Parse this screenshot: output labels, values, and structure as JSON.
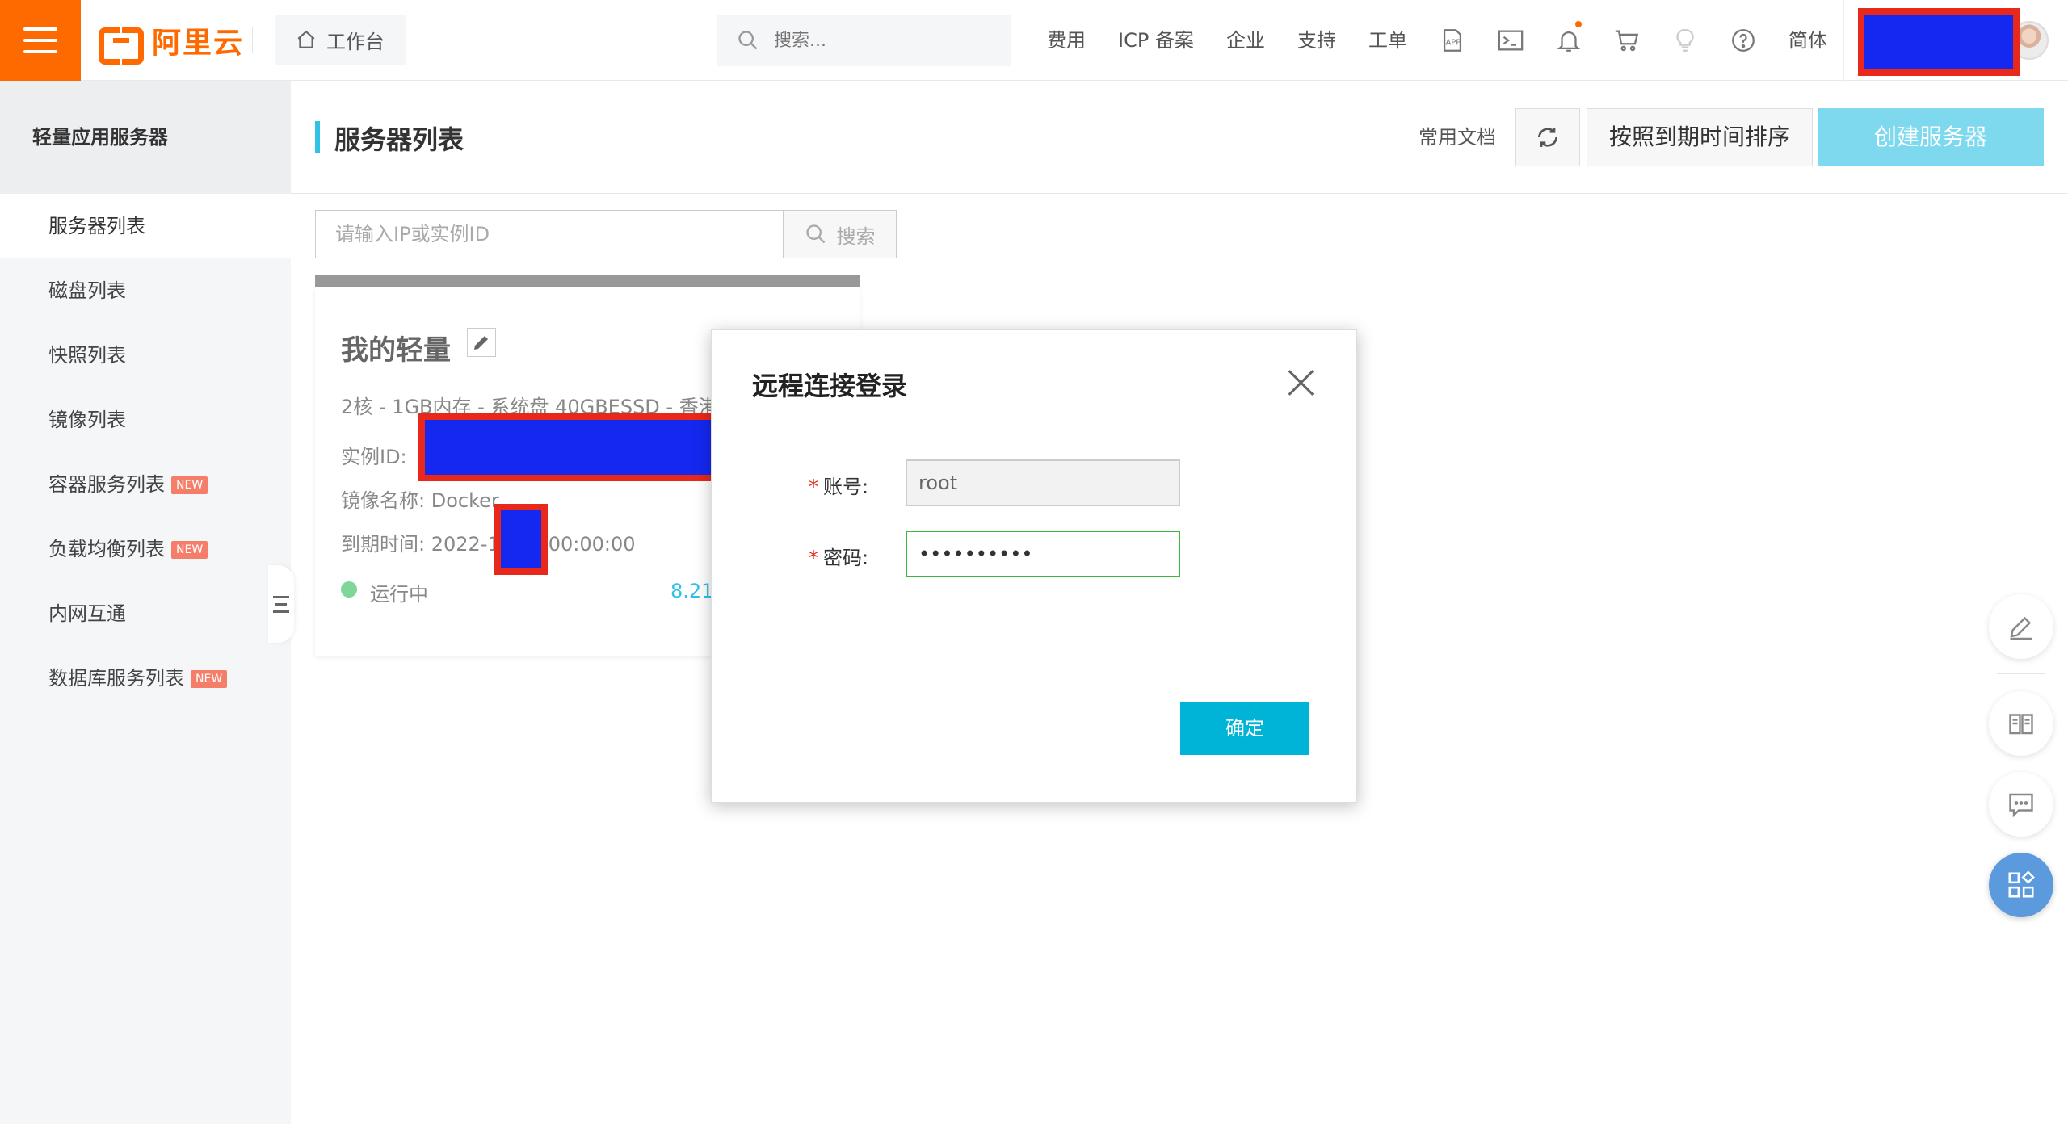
{
  "header": {
    "logo_text": "阿里云",
    "workbench_label": "工作台",
    "search_placeholder": "搜索...",
    "nav": [
      "费用",
      "ICP 备案",
      "企业",
      "支持",
      "工单"
    ],
    "lang_label": "简体",
    "icons": [
      "app-icon",
      "terminal-icon",
      "bell-icon",
      "cart-icon",
      "lightbulb-icon",
      "help-icon"
    ]
  },
  "sidebar": {
    "title": "轻量应用服务器",
    "items": [
      {
        "label": "服务器列表",
        "badge": ""
      },
      {
        "label": "磁盘列表",
        "badge": ""
      },
      {
        "label": "快照列表",
        "badge": ""
      },
      {
        "label": "镜像列表",
        "badge": ""
      },
      {
        "label": "容器服务列表",
        "badge": "NEW"
      },
      {
        "label": "负载均衡列表",
        "badge": "NEW"
      },
      {
        "label": "内网互通",
        "badge": ""
      },
      {
        "label": "数据库服务列表",
        "badge": "NEW"
      }
    ]
  },
  "page": {
    "title": "服务器列表",
    "doc_link": "常用文档",
    "sort_button": "按照到期时间排序",
    "create_button": "创建服务器",
    "filter_placeholder": "请输入IP或实例ID",
    "filter_button": "搜索"
  },
  "server_card": {
    "name": "我的轻量",
    "spec": "2核 - 1GB内存 - 系统盘 40GBESSD - 香港",
    "instance_id_label": "实例ID:",
    "image_label": "镜像名称:",
    "image_value": "Docker",
    "expire_label": "到期时间:",
    "expire_value_prefix": "2022-1",
    "expire_value_suffix": "00:00:00",
    "status": "运行中",
    "ip_partial": "8.21"
  },
  "modal": {
    "title": "远程连接登录",
    "account_label": "账号:",
    "account_value": "root",
    "password_label": "密码:",
    "password_value": "••••••••••",
    "confirm_button": "确定"
  },
  "colors": {
    "brand": "#ff6a00",
    "accent": "#00b4d8",
    "create_button": "#7fd9ee",
    "redaction_fill": "#1428f0",
    "redaction_border": "#e8281a"
  }
}
